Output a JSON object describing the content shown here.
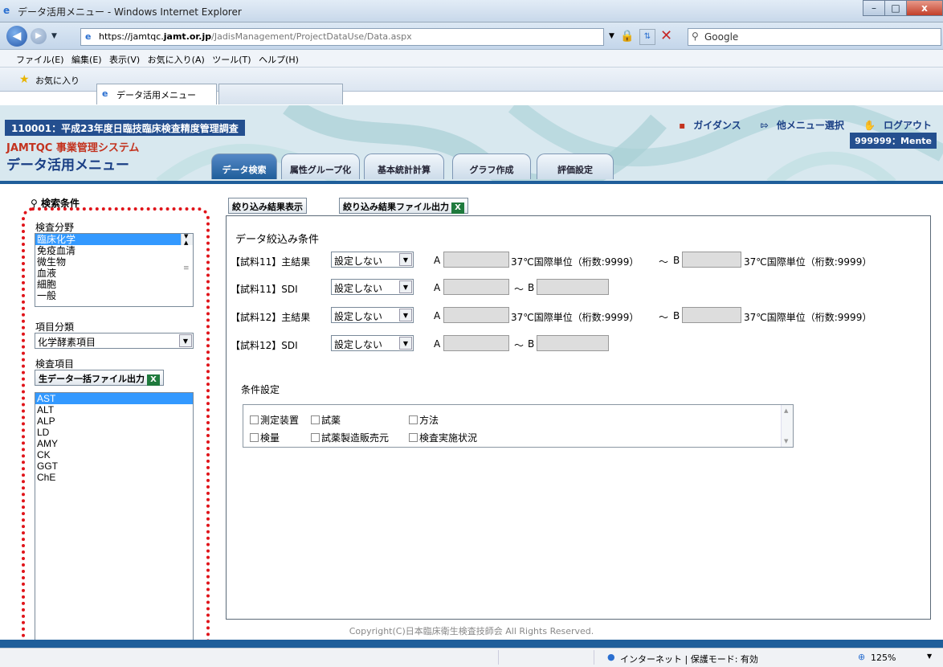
{
  "window": {
    "title": "データ活用メニュー - Windows Internet Explorer",
    "controls": [
      "–",
      "□",
      "x"
    ]
  },
  "browser": {
    "url_prefix": "https://jamtqc.",
    "url_domain": "jamt.or.jp",
    "url_path": "/JadisManagement/ProjectDataUse/Data.aspx",
    "search_placeholder": "Google",
    "menu": "ファイル(E) 編集(E) 表示(V) お気に入り(A) ツール(T) ヘルプ(H)",
    "favorites": "お気に入り",
    "tab_title": "データ活用メニュー"
  },
  "app": {
    "project_title": "110001：平成23年度日臨技臨床検査精度管理調査",
    "system_name": "JAMTQC 事業管理システム",
    "menu_title": "データ活用メニュー",
    "links": {
      "guidance": "ガイダンス",
      "other_menu": "他メニュー選択",
      "logout": "ログアウト"
    },
    "user": "999999：Mente",
    "tabs": [
      "データ検索",
      "属性グループ化",
      "基本統計計算",
      "グラフ作成",
      "評価設定"
    ]
  },
  "left": {
    "header": "検索条件",
    "category_label": "検査分野",
    "categories": [
      "臨床化学",
      "免疫血清",
      "微生物",
      "血液",
      "細胞",
      "一般"
    ],
    "item_class_label": "項目分類",
    "item_class_value": "化学酵素項目",
    "item_label": "検査項目",
    "bulk_export_button": "生データ一括ファイル出力",
    "items": [
      "AST",
      "ALT",
      "ALP",
      "LD",
      "AMY",
      "CK",
      "GGT",
      "ChE"
    ]
  },
  "main": {
    "show_button": "絞り込み結果表示",
    "export_button": "絞り込み結果ファイル出力",
    "section_title": "データ絞込み条件",
    "rows": [
      {
        "label": "【試料11】主結果",
        "select": "設定しない",
        "a": "A",
        "unit_a": "37℃国際単位（桁数:9999）",
        "tilde": "～",
        "b": "B",
        "unit_b": "37℃国際単位（桁数:9999）"
      },
      {
        "label": "【試料11】SDI",
        "select": "設定しない",
        "a": "A",
        "tilde": "～",
        "b": "B"
      },
      {
        "label": "【試料12】主結果",
        "select": "設定しない",
        "a": "A",
        "unit_a": "37℃国際単位（桁数:9999）",
        "tilde": "～",
        "b": "B",
        "unit_b": "37℃国際単位（桁数:9999）"
      },
      {
        "label": "【試料12】SDI",
        "select": "設定しない",
        "a": "A",
        "tilde": "～",
        "b": "B"
      }
    ],
    "cond_title": "条件設定",
    "checkboxes": [
      "測定装置",
      "試薬",
      "方法",
      "検量",
      "試薬製造販売元",
      "検査実施状況"
    ]
  },
  "footer": {
    "copyright": "Copyright(C)日本臨床衛生検査技師会 All Rights Reserved."
  },
  "status": {
    "zone": "インターネット | 保護モード: 有効",
    "zoom": "125%"
  },
  "colors": {
    "accent": "#1f5e9a",
    "selection": "#3399ff",
    "highlight_frame": "#e0141a"
  }
}
